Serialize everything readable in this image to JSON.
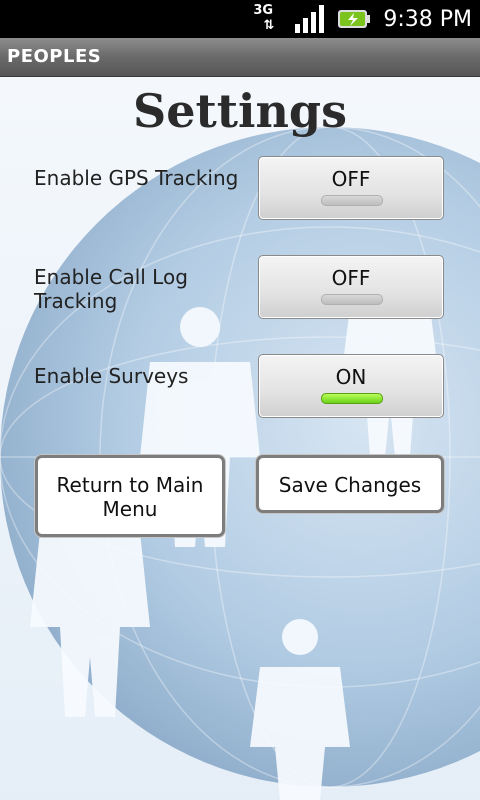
{
  "status_bar": {
    "network": "3G",
    "time": "9:38 PM"
  },
  "app": {
    "title": "PEOPLES"
  },
  "page": {
    "heading": "Settings"
  },
  "settings": [
    {
      "label": "Enable GPS Tracking",
      "state": "OFF"
    },
    {
      "label": "Enable Call Log Tracking",
      "state": "OFF"
    },
    {
      "label": "Enable Surveys",
      "state": "ON"
    }
  ],
  "actions": {
    "return_label": "Return to Main Menu",
    "save_label": "Save Changes"
  },
  "colors": {
    "toggle_on": "#7ddc22",
    "toggle_off": "#c8c8c8",
    "title_bar": "#6f6f6f"
  }
}
